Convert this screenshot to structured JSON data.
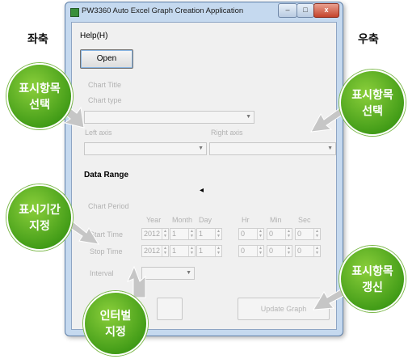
{
  "side_labels": {
    "left": "좌축",
    "right": "우축"
  },
  "window": {
    "title": "PW3360 Auto Excel Graph Creation Application"
  },
  "menu": {
    "help": "Help(H)"
  },
  "buttons": {
    "open": "Open",
    "update": "Update Graph"
  },
  "fields": {
    "chart_title": "Chart Title",
    "chart_type": "Chart type",
    "left_axis": "Left axis",
    "right_axis": "Right axis",
    "data_range": "Data Range",
    "chart_period": "Chart Period",
    "start_time": "Start Time",
    "stop_time": "Stop Time",
    "interval": "Interval"
  },
  "time_headers": [
    "Year",
    "Month",
    "Day",
    "Hr",
    "Min",
    "Sec"
  ],
  "start_values": [
    "2012",
    "1",
    "1",
    "0",
    "0",
    "0"
  ],
  "stop_values": [
    "2012",
    "1",
    "1",
    "0",
    "0",
    "0"
  ],
  "callouts": {
    "left_select": [
      "표시항목",
      "선택"
    ],
    "right_select": [
      "표시항목",
      "선택"
    ],
    "period": [
      "표시기간",
      "지정"
    ],
    "update": [
      "표시항목",
      "갱신"
    ],
    "interval": [
      "인터벌",
      "지정"
    ]
  },
  "colors": {
    "bubble": "#58b323",
    "arrow": "#c6c6c6",
    "frame": "#c5d9ef"
  }
}
